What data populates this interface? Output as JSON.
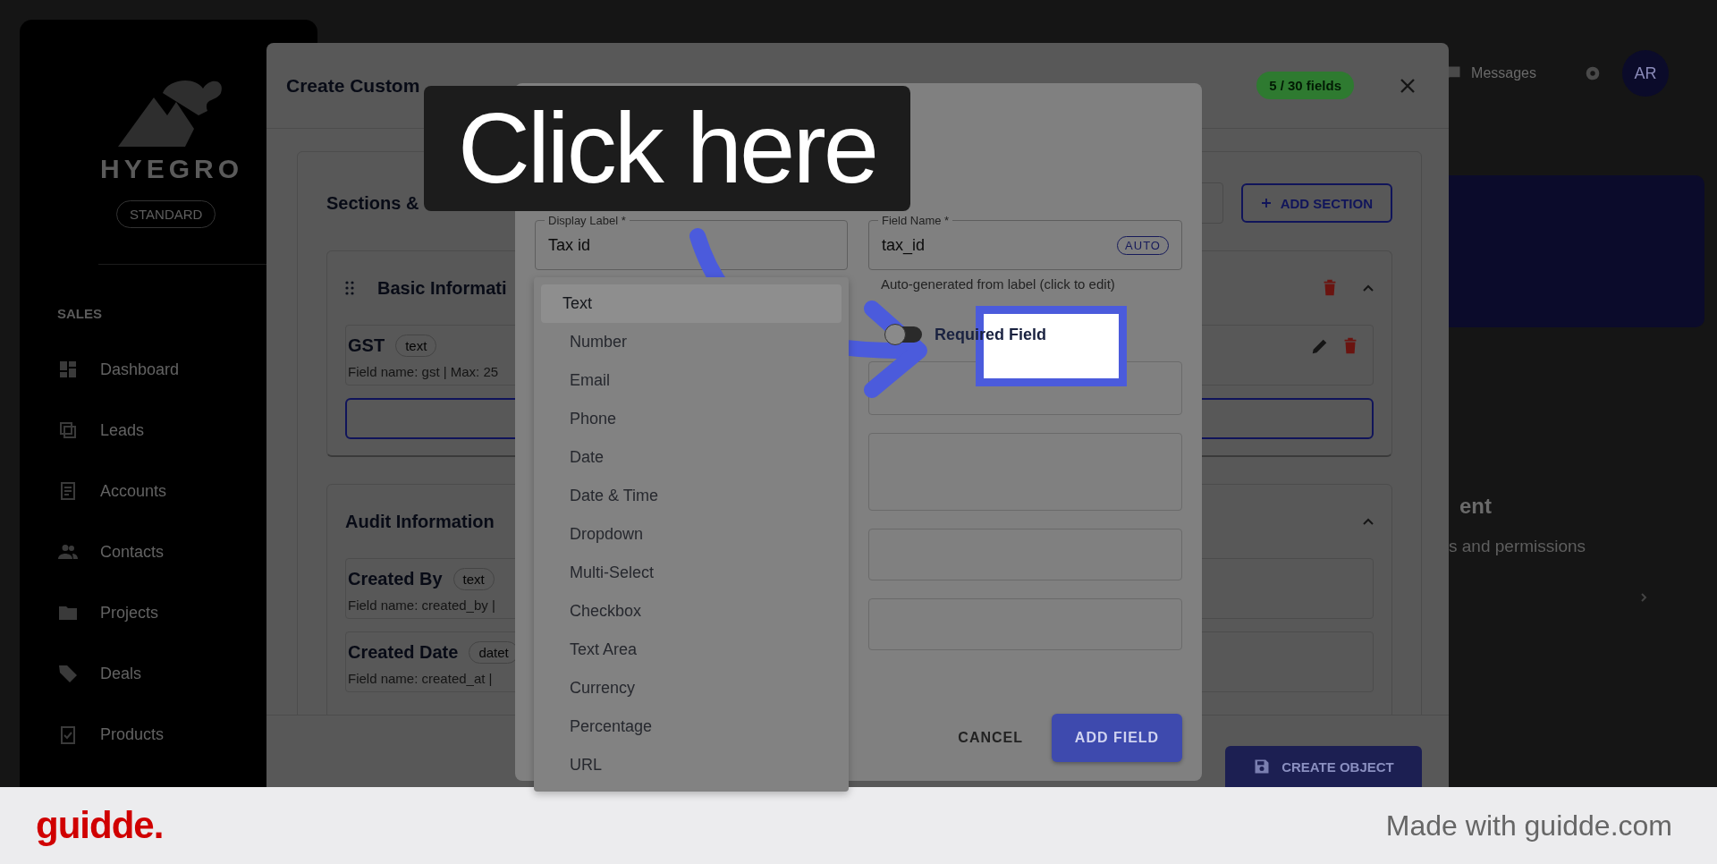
{
  "header": {
    "messages": "Messages",
    "avatar": "AR"
  },
  "sidebar": {
    "logo": "HYEGRO",
    "plan": "STANDARD",
    "section": "SALES",
    "items": [
      {
        "label": "Dashboard"
      },
      {
        "label": "Leads"
      },
      {
        "label": "Accounts"
      },
      {
        "label": "Contacts"
      },
      {
        "label": "Projects"
      },
      {
        "label": "Deals"
      },
      {
        "label": "Products"
      }
    ]
  },
  "background_card": {
    "title": "ent",
    "subtitle": "s and permissions"
  },
  "create_object": {
    "title": "Create Custom",
    "field_count": "5 / 30 fields",
    "sections_title": "Sections &",
    "add_section": "ADD SECTION",
    "create_button": "CREATE OBJECT",
    "sections": [
      {
        "title": "Basic Informati",
        "draggable": true,
        "deletable": true,
        "add_row": true,
        "fields": [
          {
            "name": "GST",
            "type": "text",
            "meta": "Field name: gst | Max: 25",
            "editable": true
          }
        ]
      },
      {
        "title": "Audit Information",
        "draggable": false,
        "deletable": false,
        "add_row": false,
        "fields": [
          {
            "name": "Created By",
            "type": "text",
            "meta": "Field name: created_by |",
            "editable": false
          },
          {
            "name": "Created Date",
            "type": "datet",
            "meta": "Field name: created_at |",
            "editable": false
          }
        ]
      }
    ]
  },
  "add_field": {
    "display_label": {
      "label": "Display Label *",
      "value": "Tax id"
    },
    "field_name": {
      "label": "Field Name *",
      "value": "tax_id",
      "badge": "AUTO",
      "helper": "Auto-generated from label (click to edit)"
    },
    "required": {
      "label": "Required Field",
      "on": false
    },
    "type_options": [
      {
        "label": "Text",
        "selected": true
      },
      {
        "label": "Number",
        "selected": false
      },
      {
        "label": "Email",
        "selected": false
      },
      {
        "label": "Phone",
        "selected": false
      },
      {
        "label": "Date",
        "selected": false
      },
      {
        "label": "Date & Time",
        "selected": false
      },
      {
        "label": "Dropdown",
        "selected": false
      },
      {
        "label": "Multi-Select",
        "selected": false
      },
      {
        "label": "Checkbox",
        "selected": false
      },
      {
        "label": "Text Area",
        "selected": false
      },
      {
        "label": "Currency",
        "selected": false
      },
      {
        "label": "Percentage",
        "selected": false
      },
      {
        "label": "URL",
        "selected": false
      }
    ],
    "cancel": "CANCEL",
    "submit": "ADD FIELD"
  },
  "tooltip": "Click here",
  "footer": {
    "brand": "guidde.",
    "credit": "Made with guidde.com"
  }
}
